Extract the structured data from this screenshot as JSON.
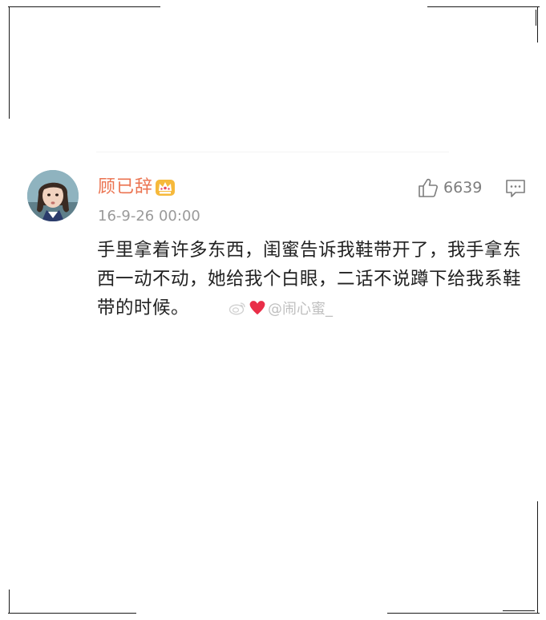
{
  "comment": {
    "username": "顾已辞",
    "timestamp": "16-9-26 00:00",
    "like_count": "6639",
    "text": "手里拿着许多东西，闺蜜告诉我鞋带开了，我手拿东西一动不动，她给我个白眼，二话不说蹲下给我系鞋带的时候。",
    "badge_icon": "crown-icon",
    "like_icon": "thumbs-up-icon",
    "reply_icon": "comment-icon",
    "username_color": "#eb7350"
  },
  "watermark": {
    "text": "@闹心蜜_",
    "icons": [
      "weibo-icon",
      "heart-icon"
    ]
  }
}
